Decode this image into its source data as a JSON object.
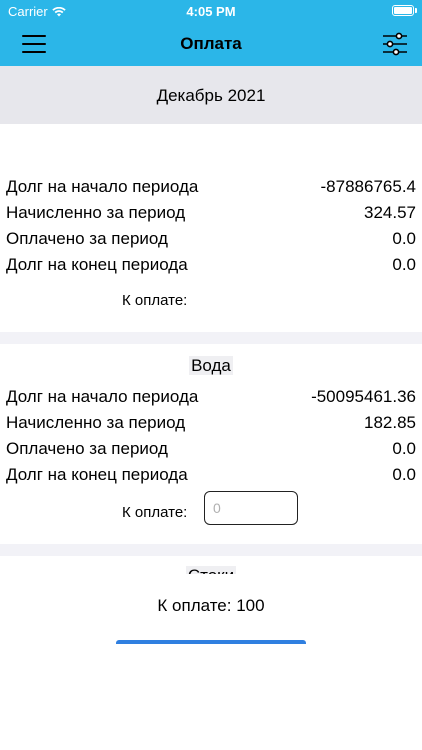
{
  "status_bar": {
    "carrier": "Carrier",
    "time": "4:05 PM"
  },
  "header": {
    "title": "Оплата"
  },
  "period": {
    "label": "Декабрь 2021"
  },
  "summary": {
    "rows": [
      {
        "label": "Долг на начало периода",
        "value": "-87886765.4"
      },
      {
        "label": "Начисленно за период",
        "value": "324.57"
      },
      {
        "label": "Оплачено за период",
        "value": "0.0"
      },
      {
        "label": "Долг на конец периода",
        "value": "0.0"
      }
    ],
    "pay_label": "К оплате:"
  },
  "services": [
    {
      "title": "Вода",
      "rows": [
        {
          "label": "Долг на начало периода",
          "value": "-50095461.36"
        },
        {
          "label": "Начисленно за период",
          "value": "182.85"
        },
        {
          "label": "Оплачено за период",
          "value": "0.0"
        },
        {
          "label": "Долг на конец периода",
          "value": "0.0"
        }
      ],
      "pay_label": "К оплате:",
      "input_placeholder": "0"
    },
    {
      "title": "Стоки"
    }
  ],
  "footer": {
    "total": "К оплате: 100"
  }
}
